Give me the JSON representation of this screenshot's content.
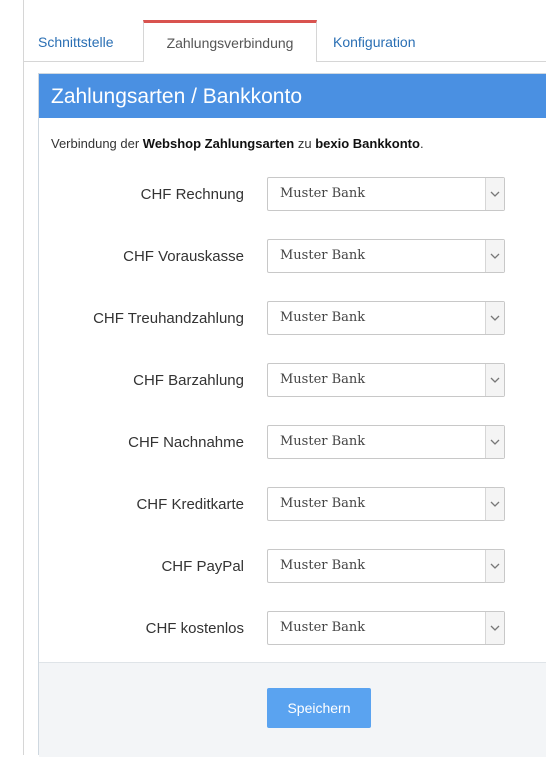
{
  "tabs": [
    {
      "label": "Schnittstelle",
      "active": false
    },
    {
      "label": "Zahlungsverbindung",
      "active": true
    },
    {
      "label": "Konfiguration",
      "active": false
    }
  ],
  "panel": {
    "title": "Zahlungsarten / Bankkonto",
    "intro": {
      "prefix": "Verbindung der ",
      "bold1": "Webshop Zahlungsarten",
      "middle": " zu ",
      "bold2": "bexio Bankkonto",
      "suffix": "."
    }
  },
  "rows": [
    {
      "label": "CHF Rechnung",
      "value": "Muster Bank"
    },
    {
      "label": "CHF Vorauskasse",
      "value": "Muster Bank"
    },
    {
      "label": "CHF Treuhandzahlung",
      "value": "Muster Bank"
    },
    {
      "label": "CHF Barzahlung",
      "value": "Muster Bank"
    },
    {
      "label": "CHF Nachnahme",
      "value": "Muster Bank"
    },
    {
      "label": "CHF Kreditkarte",
      "value": "Muster Bank"
    },
    {
      "label": "CHF PayPal",
      "value": "Muster Bank"
    },
    {
      "label": "CHF kostenlos",
      "value": "Muster Bank"
    }
  ],
  "save_label": "Speichern",
  "colors": {
    "header": "#4a90e2",
    "active_tab_accent": "#d9534f",
    "link": "#2a6fb4",
    "button": "#5aa3f0"
  },
  "icons": {
    "dropdown": "chevron-down-icon"
  }
}
